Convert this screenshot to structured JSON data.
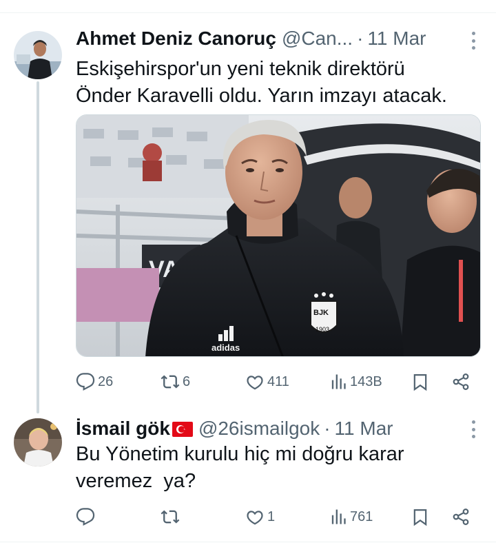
{
  "tweets": [
    {
      "name": "Ahmet Deniz Canoruç",
      "handle": "@Can...",
      "separator": "·",
      "time": "11 Mar",
      "text_lines": [
        "Eskişehirspor'un yeni teknik direktörü",
        "Önder Karavelli oldu. Yarın imzayı atacak."
      ],
      "has_media": true,
      "media_text": {
        "badge_letters": "BJK",
        "badge_year": "1903",
        "brand": "adidas",
        "board_text": "VAR"
      },
      "actions": {
        "replies": "26",
        "reposts": "6",
        "likes": "411",
        "views": "143B"
      }
    },
    {
      "name": "İsmail gök",
      "flag": "turkey-flag-icon",
      "handle": "@26ismailgok",
      "separator": "·",
      "time": "11 Mar",
      "text_lines": [
        "Bu Yönetim kurulu hiç mi doğru karar",
        "veremez  ya?"
      ],
      "actions": {
        "replies": "",
        "reposts": "",
        "likes": "1",
        "views": "761"
      }
    }
  ],
  "icons": [
    "reply-icon",
    "repost-icon",
    "like-icon",
    "views-icon",
    "bookmark-icon",
    "share-icon",
    "more-icon"
  ],
  "colors": {
    "text": "#0f1419",
    "secondary": "#536471",
    "thread_line": "#cfd9de",
    "flag_red": "#e30a17"
  }
}
